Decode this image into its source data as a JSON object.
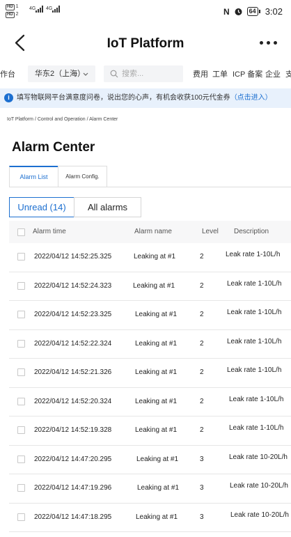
{
  "status_bar": {
    "sim1_label": "HD",
    "sim1_num": "1",
    "sim2_label": "HD",
    "sim2_num": "2",
    "network1": "4G",
    "network2": "4G",
    "battery": "64",
    "time": "3:02",
    "icons": [
      "nfc-icon",
      "alarm-icon",
      "battery-icon"
    ]
  },
  "nav": {
    "title": "IoT Platform",
    "back_icon": "chevron-left-icon",
    "more_icon": "more-dots-icon"
  },
  "console_bar": {
    "left_clip": "作台",
    "region": "华东2（上海）",
    "search_placeholder": "搜索...",
    "links": [
      "费用",
      "工单",
      "ICP 备案",
      "企业",
      "支"
    ]
  },
  "notice": {
    "text": "填写物联网平台满意度问卷，说出您的心声，有机会收获100元代金券",
    "link": "（点击进入）"
  },
  "breadcrumb": "IoT Platform / Control and Operation / Alarm Center",
  "page_title": "Alarm Center",
  "tabs": [
    {
      "label": "Alarm List"
    },
    {
      "label": "Alarm Config."
    }
  ],
  "filters": {
    "unread": "Unread (14)",
    "all": "All alarms"
  },
  "table": {
    "headers": {
      "time": "Alarm time",
      "name": "Alarm name",
      "level": "Level",
      "desc": "Description"
    },
    "rows": [
      {
        "time": "2022/04/12 14:52:25.325",
        "name": "Leaking at #1",
        "level": "2",
        "desc": "Leak rate 1-10L/h"
      },
      {
        "time": "2022/04/12 14:52:24.323",
        "name": "Leaking at #1",
        "level": "2",
        "desc": "Leak rate 1-10L/h"
      },
      {
        "time": "2022/04/12 14:52:23.325",
        "name": "Leaking at #1",
        "level": "2",
        "desc": "Leak rate 1-10L/h"
      },
      {
        "time": "2022/04/12 14:52:22.324",
        "name": "Leaking at #1",
        "level": "2",
        "desc": "Leak rate 1-10L/h"
      },
      {
        "time": "2022/04/12 14:52:21.326",
        "name": "Leaking at #1",
        "level": "2",
        "desc": "Leak rate 1-10L/h"
      },
      {
        "time": "2022/04/12 14:52:20.324",
        "name": "Leaking at #1",
        "level": "2",
        "desc": "Leak rate 1-10L/h"
      },
      {
        "time": "2022/04/12 14:52:19.328",
        "name": "Leaking at #1",
        "level": "2",
        "desc": "Leak rate 1-10L/h"
      },
      {
        "time": "2022/04/12 14:47:20.295",
        "name": "Leaking at #1",
        "level": "3",
        "desc": "Leak rate 10-20L/h"
      },
      {
        "time": "2022/04/12 14:47:19.296",
        "name": "Leaking at #1",
        "level": "3",
        "desc": "Leak rate 10-20L/h"
      },
      {
        "time": "2022/04/12 14:47:18.295",
        "name": "Leaking at #1",
        "level": "3",
        "desc": "Leak rate 10-20L/h"
      }
    ]
  },
  "colors": {
    "accent": "#1c6fd0",
    "notice_bg": "#e8f1fc",
    "header_bg": "#f7f7f8"
  }
}
